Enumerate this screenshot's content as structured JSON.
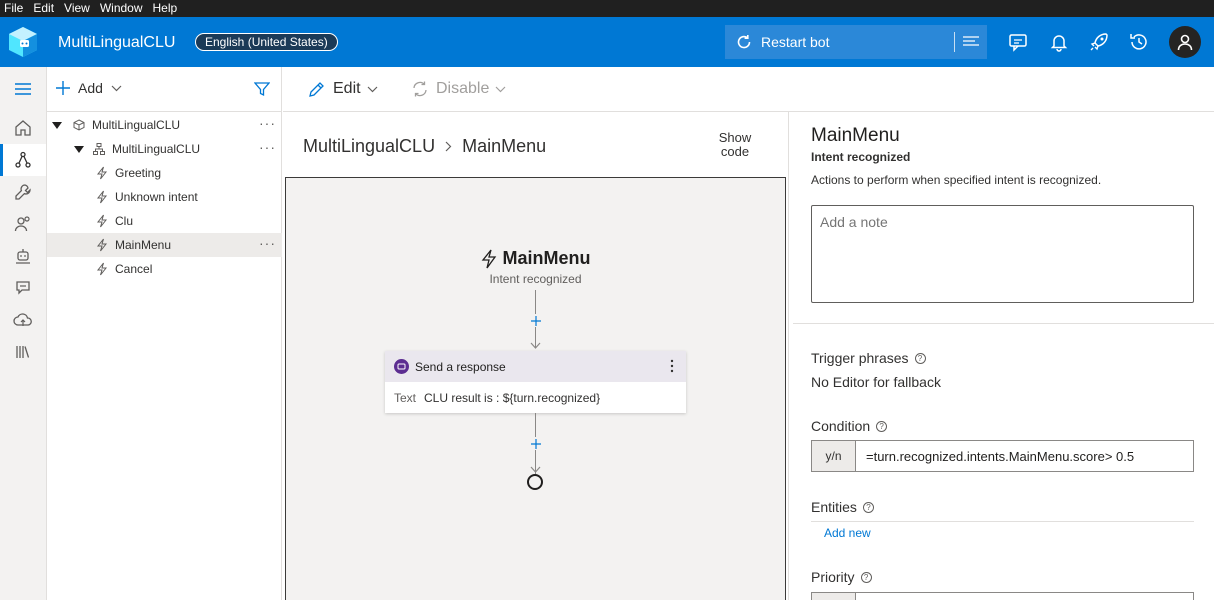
{
  "menubar": {
    "items": [
      "File",
      "Edit",
      "View",
      "Window",
      "Help"
    ]
  },
  "header": {
    "app_title": "MultiLingualCLU",
    "locale": "English (United States)",
    "restart_label": "Restart bot",
    "icons": [
      "chat-icon",
      "bell-icon",
      "rocket-icon",
      "history-icon",
      "user-icon"
    ]
  },
  "rail": {
    "icons": [
      "home-icon",
      "design-icon",
      "wrench-icon",
      "users-icon",
      "bot-icon",
      "chat-bubble-icon",
      "cloud-upload-icon",
      "library-icon"
    ]
  },
  "tree": {
    "add_label": "Add",
    "items": [
      {
        "label": "MultiLingualCLU",
        "level": 0
      },
      {
        "label": "MultiLingualCLU",
        "level": 1
      },
      {
        "label": "Greeting",
        "level": 2
      },
      {
        "label": "Unknown intent",
        "level": 2
      },
      {
        "label": "Clu",
        "level": 2
      },
      {
        "label": "MainMenu",
        "level": 2,
        "selected": true
      },
      {
        "label": "Cancel",
        "level": 2
      }
    ],
    "more": "···"
  },
  "commandbar": {
    "edit_label": "Edit",
    "disable_label": "Disable"
  },
  "breadcrumb": {
    "root": "MultiLingualCLU",
    "current": "MainMenu"
  },
  "showcode": {
    "line1": "Show",
    "line2": "code"
  },
  "canvas": {
    "trigger_title": "MainMenu",
    "trigger_sub": "Intent recognized",
    "card_title": "Send a response",
    "card_key": "Text",
    "card_value": "CLU result is : ${turn.recognized}"
  },
  "props": {
    "title": "MainMenu",
    "subtitle": "Intent recognized",
    "description": "Actions to perform when specified intent is recognized.",
    "note_placeholder": "Add a note",
    "trigger_phrases_label": "Trigger phrases",
    "trigger_phrases_value": "No Editor for fallback",
    "condition_label": "Condition",
    "condition_prefix": "y/n",
    "condition_value": "=turn.recognized.intents.MainMenu.score> 0.5",
    "entities_label": "Entities",
    "add_new": "Add new",
    "priority_label": "Priority",
    "help_glyph": "?"
  },
  "colors": {
    "accent": "#0078d4",
    "header_bg": "#0078d4",
    "menubar_bg": "#202020",
    "card_badge": "#5c2d91"
  }
}
